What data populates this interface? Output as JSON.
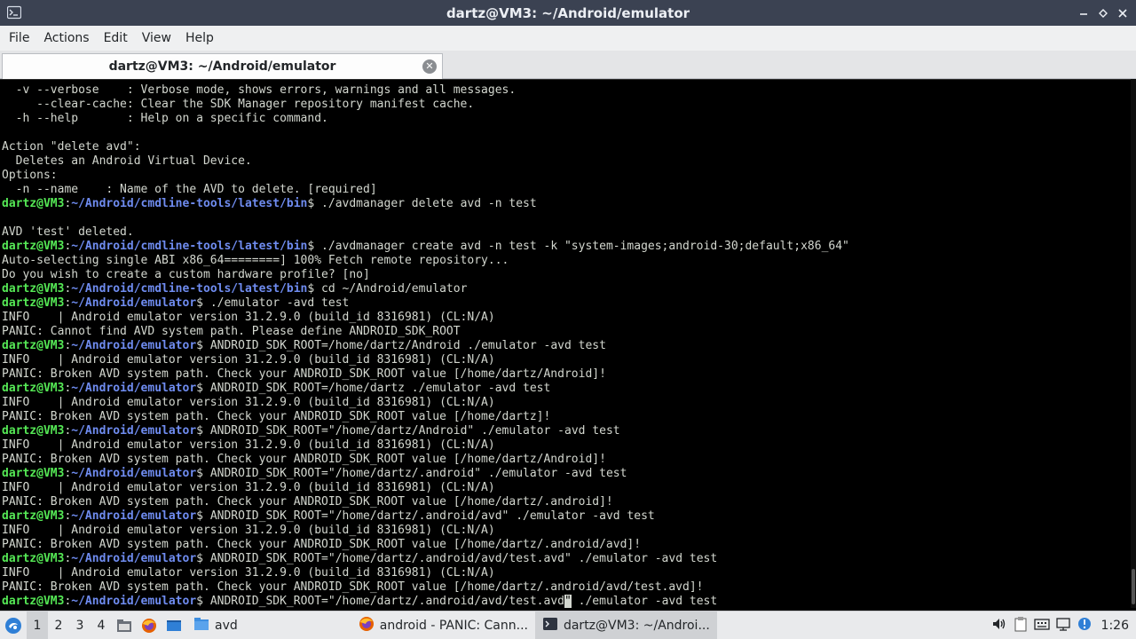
{
  "window": {
    "title": "dartz@VM3: ~/Android/emulator",
    "controls": [
      "minimize",
      "maximize",
      "close"
    ]
  },
  "menu": [
    "File",
    "Actions",
    "Edit",
    "View",
    "Help"
  ],
  "tab": {
    "label": "dartz@VM3: ~/Android/emulator"
  },
  "terminal": {
    "lines": [
      {
        "text": "  -v --verbose    : Verbose mode, shows errors, warnings and all messages."
      },
      {
        "text": "     --clear-cache: Clear the SDK Manager repository manifest cache."
      },
      {
        "text": "  -h --help       : Help on a specific command."
      },
      {
        "text": ""
      },
      {
        "text": "Action \"delete avd\":"
      },
      {
        "text": "  Deletes an Android Virtual Device."
      },
      {
        "text": "Options:"
      },
      {
        "text": "  -n --name    : Name of the AVD to delete. [required]"
      },
      {
        "prompt": {
          "user": "dartz@VM3",
          "path": "~/Android/cmdline-tools/latest/bin"
        },
        "text": "./avdmanager delete avd -n test"
      },
      {
        "text": ""
      },
      {
        "text": "AVD 'test' deleted."
      },
      {
        "prompt": {
          "user": "dartz@VM3",
          "path": "~/Android/cmdline-tools/latest/bin"
        },
        "text": "./avdmanager create avd -n test -k \"system-images;android-30;default;x86_64\""
      },
      {
        "text": "Auto-selecting single ABI x86_64========] 100% Fetch remote repository..."
      },
      {
        "text": "Do you wish to create a custom hardware profile? [no]"
      },
      {
        "prompt": {
          "user": "dartz@VM3",
          "path": "~/Android/cmdline-tools/latest/bin"
        },
        "text": "cd ~/Android/emulator"
      },
      {
        "prompt": {
          "user": "dartz@VM3",
          "path": "~/Android/emulator"
        },
        "text": "./emulator -avd test"
      },
      {
        "text": "INFO    | Android emulator version 31.2.9.0 (build_id 8316981) (CL:N/A)"
      },
      {
        "text": "PANIC: Cannot find AVD system path. Please define ANDROID_SDK_ROOT"
      },
      {
        "prompt": {
          "user": "dartz@VM3",
          "path": "~/Android/emulator"
        },
        "text": "ANDROID_SDK_ROOT=/home/dartz/Android ./emulator -avd test"
      },
      {
        "text": "INFO    | Android emulator version 31.2.9.0 (build_id 8316981) (CL:N/A)"
      },
      {
        "text": "PANIC: Broken AVD system path. Check your ANDROID_SDK_ROOT value [/home/dartz/Android]!"
      },
      {
        "prompt": {
          "user": "dartz@VM3",
          "path": "~/Android/emulator"
        },
        "text": "ANDROID_SDK_ROOT=/home/dartz ./emulator -avd test"
      },
      {
        "text": "INFO    | Android emulator version 31.2.9.0 (build_id 8316981) (CL:N/A)"
      },
      {
        "text": "PANIC: Broken AVD system path. Check your ANDROID_SDK_ROOT value [/home/dartz]!"
      },
      {
        "prompt": {
          "user": "dartz@VM3",
          "path": "~/Android/emulator"
        },
        "text": "ANDROID_SDK_ROOT=\"/home/dartz/Android\" ./emulator -avd test"
      },
      {
        "text": "INFO    | Android emulator version 31.2.9.0 (build_id 8316981) (CL:N/A)"
      },
      {
        "text": "PANIC: Broken AVD system path. Check your ANDROID_SDK_ROOT value [/home/dartz/Android]!"
      },
      {
        "prompt": {
          "user": "dartz@VM3",
          "path": "~/Android/emulator"
        },
        "text": "ANDROID_SDK_ROOT=\"/home/dartz/.android\" ./emulator -avd test"
      },
      {
        "text": "INFO    | Android emulator version 31.2.9.0 (build_id 8316981) (CL:N/A)"
      },
      {
        "text": "PANIC: Broken AVD system path. Check your ANDROID_SDK_ROOT value [/home/dartz/.android]!"
      },
      {
        "prompt": {
          "user": "dartz@VM3",
          "path": "~/Android/emulator"
        },
        "text": "ANDROID_SDK_ROOT=\"/home/dartz/.android/avd\" ./emulator -avd test"
      },
      {
        "text": "INFO    | Android emulator version 31.2.9.0 (build_id 8316981) (CL:N/A)"
      },
      {
        "text": "PANIC: Broken AVD system path. Check your ANDROID_SDK_ROOT value [/home/dartz/.android/avd]!"
      },
      {
        "prompt": {
          "user": "dartz@VM3",
          "path": "~/Android/emulator"
        },
        "text": "ANDROID_SDK_ROOT=\"/home/dartz/.android/avd/test.avd\" ./emulator -avd test"
      },
      {
        "text": "INFO    | Android emulator version 31.2.9.0 (build_id 8316981) (CL:N/A)"
      },
      {
        "text": "PANIC: Broken AVD system path. Check your ANDROID_SDK_ROOT value [/home/dartz/.android/avd/test.avd]!"
      },
      {
        "prompt": {
          "user": "dartz@VM3",
          "path": "~/Android/emulator"
        },
        "text": "ANDROID_SDK_ROOT=\"/home/dartz/.android/avd/test.avd",
        "cursor": "\"",
        "after": " ./emulator -avd test"
      }
    ]
  },
  "taskbar": {
    "workspaces": [
      "1",
      "2",
      "3",
      "4"
    ],
    "active_workspace": "1",
    "launchers": [
      {
        "icon": "start-menu-icon"
      },
      {
        "icon": "files-icon"
      },
      {
        "icon": "firefox-icon"
      },
      {
        "icon": "desktop-icon"
      }
    ],
    "folder_label": "avd",
    "tasks": [
      {
        "icon": "firefox-icon",
        "label": "android - PANIC: Cann..."
      },
      {
        "icon": "terminal-icon",
        "label": "dartz@VM3: ~/Androi..."
      }
    ],
    "tray_icons": [
      "volume-icon",
      "clipboard-icon",
      "keyboard-icon",
      "network-icon",
      "update-icon"
    ],
    "clock": "1:26"
  },
  "colors": {
    "prompt_user": "#55e855",
    "prompt_path": "#6f8cf0",
    "terminal_bg": "#000000",
    "terminal_fg": "#d3d7cf",
    "titlebar_bg": "#3b4252"
  }
}
